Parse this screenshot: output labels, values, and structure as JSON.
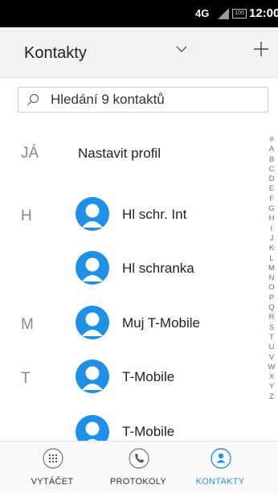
{
  "status": {
    "network": "4G",
    "battery": "100",
    "time": "12:00"
  },
  "header": {
    "title": "Kontakty"
  },
  "search": {
    "placeholder": "Hledání 9 kontaktů"
  },
  "me": {
    "letter": "JÁ",
    "label": "Nastavit profil"
  },
  "sections": [
    {
      "letter": "H",
      "contacts": [
        "Hl schr. Int",
        "Hl schranka"
      ]
    },
    {
      "letter": "M",
      "contacts": [
        "Muj T-Mobile"
      ]
    },
    {
      "letter": "T",
      "contacts": [
        "T-Mobile",
        "T-Mobile"
      ]
    }
  ],
  "alphabet": [
    "#",
    "A",
    "B",
    "C",
    "D",
    "E",
    "F",
    "G",
    "H",
    "I",
    "J",
    "K",
    "L",
    "M",
    "N",
    "O",
    "P",
    "Q",
    "R",
    "S",
    "T",
    "U",
    "V",
    "W",
    "X",
    "Y",
    "Z"
  ],
  "nav": {
    "dialer": "VYTÁČET",
    "logs": "PROTOKOLY",
    "contacts": "KONTAKTY",
    "active": "contacts"
  },
  "colors": {
    "accent": "#2196e6",
    "avatar": "#1e90e8",
    "status_bar": "#000000"
  }
}
